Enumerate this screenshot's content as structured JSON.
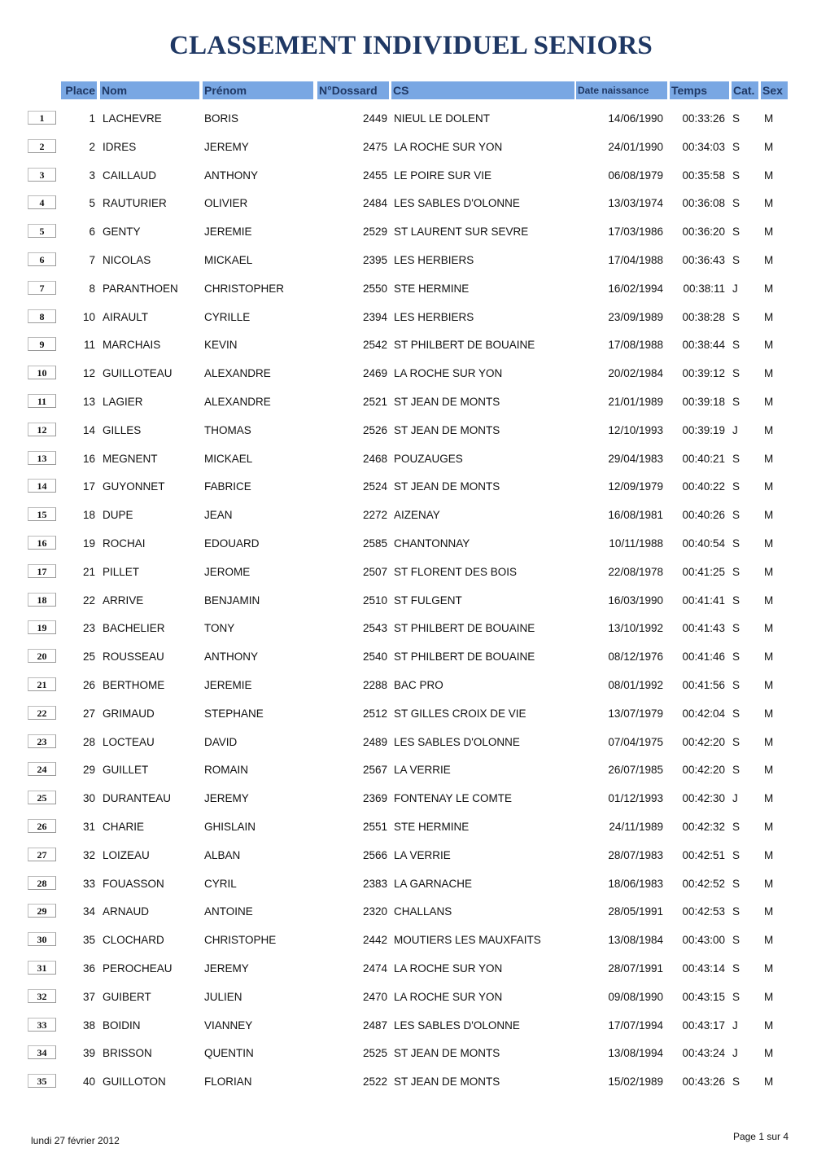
{
  "title": "CLASSEMENT INDIVIDUEL SENIORS",
  "headers": {
    "place": "Place",
    "nom": "Nom",
    "prenom": "Prénom",
    "dossard": "N°Dossard",
    "cs": "CS",
    "date": "Date naissance",
    "temps": "Temps",
    "cat": "Cat.",
    "sex": "Sex"
  },
  "header_color": "#79a7e3",
  "title_color": "#1f3864",
  "rows": [
    [
      "1",
      "1",
      "LACHEVRE",
      "BORIS",
      "2449",
      "NIEUL LE DOLENT",
      "14/06/1990",
      "00:33:26",
      "S",
      "M"
    ],
    [
      "2",
      "2",
      "IDRES",
      "JEREMY",
      "2475",
      "LA ROCHE SUR YON",
      "24/01/1990",
      "00:34:03",
      "S",
      "M"
    ],
    [
      "3",
      "3",
      "CAILLAUD",
      "ANTHONY",
      "2455",
      "LE POIRE SUR VIE",
      "06/08/1979",
      "00:35:58",
      "S",
      "M"
    ],
    [
      "4",
      "5",
      "RAUTURIER",
      "OLIVIER",
      "2484",
      "LES SABLES D'OLONNE",
      "13/03/1974",
      "00:36:08",
      "S",
      "M"
    ],
    [
      "5",
      "6",
      "GENTY",
      "JEREMIE",
      "2529",
      "ST LAURENT SUR SEVRE",
      "17/03/1986",
      "00:36:20",
      "S",
      "M"
    ],
    [
      "6",
      "7",
      "NICOLAS",
      "MICKAEL",
      "2395",
      "LES HERBIERS",
      "17/04/1988",
      "00:36:43",
      "S",
      "M"
    ],
    [
      "7",
      "8",
      "PARANTHOEN",
      "CHRISTOPHER",
      "2550",
      "STE HERMINE",
      "16/02/1994",
      "00:38:11",
      "J",
      "M"
    ],
    [
      "8",
      "10",
      "AIRAULT",
      "CYRILLE",
      "2394",
      "LES HERBIERS",
      "23/09/1989",
      "00:38:28",
      "S",
      "M"
    ],
    [
      "9",
      "11",
      "MARCHAIS",
      "KEVIN",
      "2542",
      "ST PHILBERT DE BOUAINE",
      "17/08/1988",
      "00:38:44",
      "S",
      "M"
    ],
    [
      "10",
      "12",
      "GUILLOTEAU",
      "ALEXANDRE",
      "2469",
      "LA ROCHE SUR YON",
      "20/02/1984",
      "00:39:12",
      "S",
      "M"
    ],
    [
      "11",
      "13",
      "LAGIER",
      "ALEXANDRE",
      "2521",
      "ST JEAN DE MONTS",
      "21/01/1989",
      "00:39:18",
      "S",
      "M"
    ],
    [
      "12",
      "14",
      "GILLES",
      "THOMAS",
      "2526",
      "ST JEAN DE MONTS",
      "12/10/1993",
      "00:39:19",
      "J",
      "M"
    ],
    [
      "13",
      "16",
      "MEGNENT",
      "MICKAEL",
      "2468",
      "POUZAUGES",
      "29/04/1983",
      "00:40:21",
      "S",
      "M"
    ],
    [
      "14",
      "17",
      "GUYONNET",
      "FABRICE",
      "2524",
      "ST JEAN DE MONTS",
      "12/09/1979",
      "00:40:22",
      "S",
      "M"
    ],
    [
      "15",
      "18",
      "DUPE",
      "JEAN",
      "2272",
      "AIZENAY",
      "16/08/1981",
      "00:40:26",
      "S",
      "M"
    ],
    [
      "16",
      "19",
      "ROCHAI",
      "EDOUARD",
      "2585",
      "CHANTONNAY",
      "10/11/1988",
      "00:40:54",
      "S",
      "M"
    ],
    [
      "17",
      "21",
      "PILLET",
      "JEROME",
      "2507",
      "ST FLORENT DES BOIS",
      "22/08/1978",
      "00:41:25",
      "S",
      "M"
    ],
    [
      "18",
      "22",
      "ARRIVE",
      "BENJAMIN",
      "2510",
      "ST FULGENT",
      "16/03/1990",
      "00:41:41",
      "S",
      "M"
    ],
    [
      "19",
      "23",
      "BACHELIER",
      "TONY",
      "2543",
      "ST PHILBERT DE BOUAINE",
      "13/10/1992",
      "00:41:43",
      "S",
      "M"
    ],
    [
      "20",
      "25",
      "ROUSSEAU",
      "ANTHONY",
      "2540",
      "ST PHILBERT DE BOUAINE",
      "08/12/1976",
      "00:41:46",
      "S",
      "M"
    ],
    [
      "21",
      "26",
      "BERTHOME",
      "JEREMIE",
      "2288",
      "BAC PRO",
      "08/01/1992",
      "00:41:56",
      "S",
      "M"
    ],
    [
      "22",
      "27",
      "GRIMAUD",
      "STEPHANE",
      "2512",
      "ST GILLES CROIX DE VIE",
      "13/07/1979",
      "00:42:04",
      "S",
      "M"
    ],
    [
      "23",
      "28",
      "LOCTEAU",
      "DAVID",
      "2489",
      "LES SABLES D'OLONNE",
      "07/04/1975",
      "00:42:20",
      "S",
      "M"
    ],
    [
      "24",
      "29",
      "GUILLET",
      "ROMAIN",
      "2567",
      "LA VERRIE",
      "26/07/1985",
      "00:42:20",
      "S",
      "M"
    ],
    [
      "25",
      "30",
      "DURANTEAU",
      "JEREMY",
      "2369",
      "FONTENAY LE COMTE",
      "01/12/1993",
      "00:42:30",
      "J",
      "M"
    ],
    [
      "26",
      "31",
      "CHARIE",
      "GHISLAIN",
      "2551",
      "STE HERMINE",
      "24/11/1989",
      "00:42:32",
      "S",
      "M"
    ],
    [
      "27",
      "32",
      "LOIZEAU",
      "ALBAN",
      "2566",
      "LA VERRIE",
      "28/07/1983",
      "00:42:51",
      "S",
      "M"
    ],
    [
      "28",
      "33",
      "FOUASSON",
      "CYRIL",
      "2383",
      "LA GARNACHE",
      "18/06/1983",
      "00:42:52",
      "S",
      "M"
    ],
    [
      "29",
      "34",
      "ARNAUD",
      "ANTOINE",
      "2320",
      "CHALLANS",
      "28/05/1991",
      "00:42:53",
      "S",
      "M"
    ],
    [
      "30",
      "35",
      "CLOCHARD",
      "CHRISTOPHE",
      "2442",
      "MOUTIERS LES MAUXFAITS",
      "13/08/1984",
      "00:43:00",
      "S",
      "M"
    ],
    [
      "31",
      "36",
      "PEROCHEAU",
      "JEREMY",
      "2474",
      "LA ROCHE SUR YON",
      "28/07/1991",
      "00:43:14",
      "S",
      "M"
    ],
    [
      "32",
      "37",
      "GUIBERT",
      "JULIEN",
      "2470",
      "LA ROCHE SUR YON",
      "09/08/1990",
      "00:43:15",
      "S",
      "M"
    ],
    [
      "33",
      "38",
      "BOIDIN",
      "VIANNEY",
      "2487",
      "LES SABLES D'OLONNE",
      "17/07/1994",
      "00:43:17",
      "J",
      "M"
    ],
    [
      "34",
      "39",
      "BRISSON",
      "QUENTIN",
      "2525",
      "ST JEAN DE MONTS",
      "13/08/1994",
      "00:43:24",
      "J",
      "M"
    ],
    [
      "35",
      "40",
      "GUILLOTON",
      "FLORIAN",
      "2522",
      "ST JEAN DE MONTS",
      "15/02/1989",
      "00:43:26",
      "S",
      "M"
    ]
  ],
  "footer": {
    "date": "lundi 27 février 2012",
    "page": "Page 1 sur 4"
  }
}
